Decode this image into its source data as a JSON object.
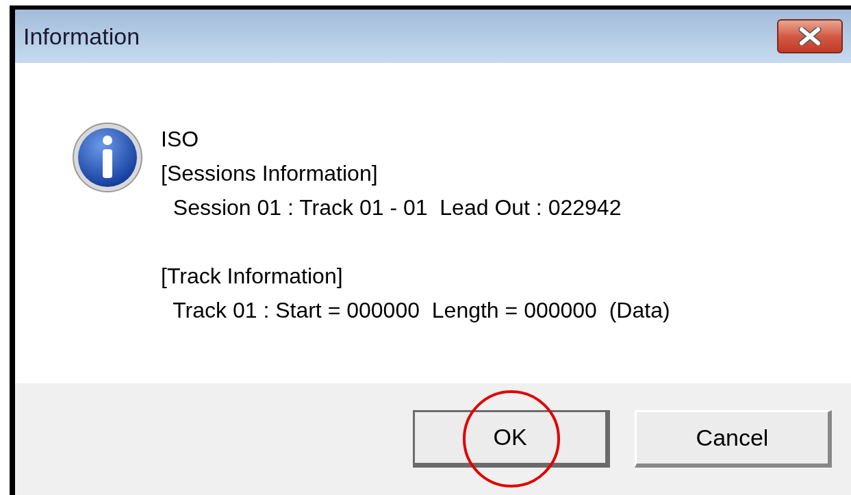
{
  "window": {
    "title": "Information"
  },
  "message": {
    "groups": [
      {
        "lines": [
          "ISO",
          "[Sessions Information]",
          "  Session 01 : Track 01 - 01  Lead Out : 022942"
        ]
      },
      {
        "lines": [
          "[Track Information]",
          "  Track 01 : Start = 000000  Length = 000000  (Data)"
        ]
      }
    ]
  },
  "buttons": [
    {
      "label": "OK",
      "default": true,
      "circled": true
    },
    {
      "label": "Cancel",
      "default": false,
      "circled": false
    }
  ]
}
